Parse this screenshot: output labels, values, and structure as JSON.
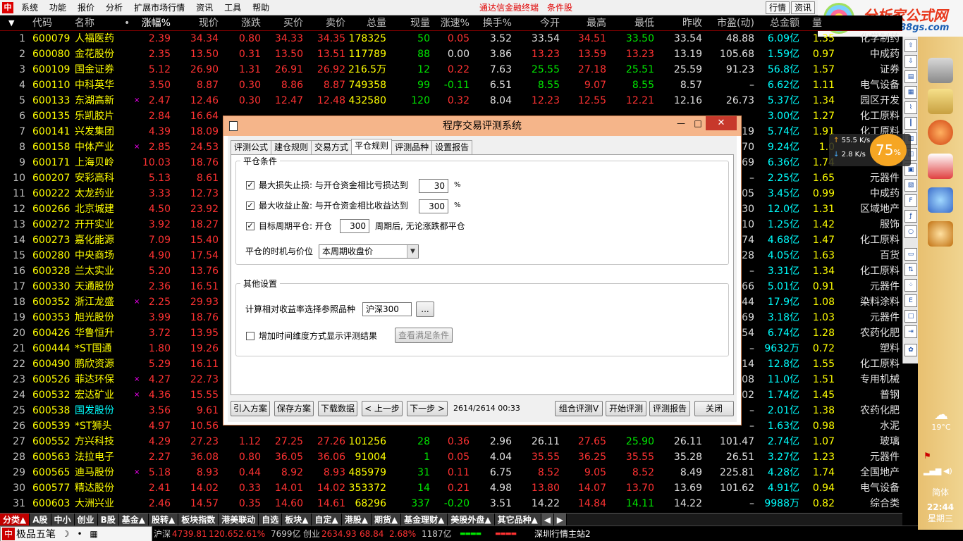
{
  "menubar": {
    "app_icon": "中",
    "items": [
      "系统",
      "功能",
      "报价",
      "分析",
      "扩展市场行情",
      "资讯",
      "工具",
      "帮助"
    ],
    "brand": "通达信金融终端",
    "brand2": "条件股",
    "btn_quote": "行情",
    "btn_info": "资讯"
  },
  "logo": {
    "title": "分析家公式网",
    "url": "www.88gs.com"
  },
  "table": {
    "headers": [
      "代码",
      "名称",
      "•",
      "涨幅%",
      "现价",
      "涨跌",
      "买价",
      "卖价",
      "总量",
      "现量",
      "涨速%",
      "换手%",
      "今开",
      "最高",
      "最低",
      "昨收",
      "市盈(动)",
      "总金额",
      "量"
    ],
    "rows": [
      {
        "idx": "1",
        "code": "600079",
        "name": "人福医药",
        "mark": "",
        "chg_pct": "2.39",
        "price": "34.34",
        "chg": "0.80",
        "bid": "34.33",
        "ask": "34.35",
        "vol": "178325",
        "cur": "50",
        "speed": "0.05",
        "turn": "3.52",
        "open": "33.54",
        "high": "34.51",
        "low": "33.50",
        "prev": "33.54",
        "pe": "48.88",
        "amt": "6.09亿",
        "ratio": "1.35",
        "ind": "化学制药"
      },
      {
        "idx": "2",
        "code": "600080",
        "name": "金花股份",
        "mark": "",
        "chg_pct": "2.35",
        "price": "13.50",
        "chg": "0.31",
        "bid": "13.50",
        "ask": "13.51",
        "vol": "117789",
        "cur": "88",
        "speed": "0.00",
        "turn": "3.86",
        "open": "13.23",
        "high": "13.59",
        "low": "13.23",
        "prev": "13.19",
        "pe": "105.68",
        "amt": "1.59亿",
        "ratio": "0.97",
        "ind": "中成药"
      },
      {
        "idx": "3",
        "code": "600109",
        "name": "国金证券",
        "mark": "",
        "chg_pct": "5.12",
        "price": "26.90",
        "chg": "1.31",
        "bid": "26.91",
        "ask": "26.92",
        "vol": "216.5万",
        "cur": "12",
        "speed": "0.22",
        "turn": "7.63",
        "open": "25.55",
        "high": "27.18",
        "low": "25.51",
        "prev": "25.59",
        "pe": "91.23",
        "amt": "56.8亿",
        "ratio": "1.57",
        "ind": "证券"
      },
      {
        "idx": "4",
        "code": "600110",
        "name": "中科英华",
        "mark": "",
        "chg_pct": "3.50",
        "price": "8.87",
        "chg": "0.30",
        "bid": "8.86",
        "ask": "8.87",
        "vol": "749358",
        "cur": "99",
        "speed": "-0.11",
        "turn": "6.51",
        "open": "8.55",
        "high": "9.07",
        "low": "8.55",
        "prev": "8.57",
        "pe": "–",
        "amt": "6.62亿",
        "ratio": "1.11",
        "ind": "电气设备"
      },
      {
        "idx": "5",
        "code": "600133",
        "name": "东湖高新",
        "mark": "×",
        "chg_pct": "2.47",
        "price": "12.46",
        "chg": "0.30",
        "bid": "12.47",
        "ask": "12.48",
        "vol": "432580",
        "cur": "120",
        "speed": "0.32",
        "turn": "8.04",
        "open": "12.23",
        "high": "12.55",
        "low": "12.21",
        "prev": "12.16",
        "pe": "26.73",
        "amt": "5.37亿",
        "ratio": "1.34",
        "ind": "园区开发"
      },
      {
        "idx": "6",
        "code": "600135",
        "name": "乐凯胶片",
        "mark": "",
        "chg_pct": "2.84",
        "price": "16.64",
        "chg": "",
        "bid": "",
        "ask": "",
        "vol": "",
        "cur": "",
        "speed": "",
        "turn": "",
        "open": "",
        "high": "",
        "low": "",
        "prev": "",
        "pe": "",
        "amt": "3.00亿",
        "ratio": "1.27",
        "ind": "化工原料"
      },
      {
        "idx": "7",
        "code": "600141",
        "name": "兴发集团",
        "mark": "",
        "chg_pct": "4.39",
        "price": "18.09",
        "chg": "",
        "bid": "",
        "ask": "",
        "vol": "",
        "cur": "",
        "speed": "",
        "turn": "",
        "open": "",
        "high": "",
        "low": "",
        "prev": "",
        "pe": "19",
        "amt": "5.74亿",
        "ratio": "1.91",
        "ind": "化工原料"
      },
      {
        "idx": "8",
        "code": "600158",
        "name": "中体产业",
        "mark": "×",
        "chg_pct": "2.85",
        "price": "24.53",
        "chg": "",
        "bid": "",
        "ask": "",
        "vol": "",
        "cur": "",
        "speed": "",
        "turn": "",
        "open": "",
        "high": "",
        "low": "",
        "prev": "",
        "pe": "70",
        "amt": "9.24亿",
        "ratio": "1.0",
        "ind": ""
      },
      {
        "idx": "9",
        "code": "600171",
        "name": "上海贝岭",
        "mark": "",
        "chg_pct": "10.03",
        "price": "18.76",
        "chg": "",
        "bid": "",
        "ask": "",
        "vol": "",
        "cur": "",
        "speed": "",
        "turn": "",
        "open": "",
        "high": "",
        "low": "",
        "prev": "",
        "pe": "69",
        "amt": "6.36亿",
        "ratio": "1.74",
        "ind": ""
      },
      {
        "idx": "10",
        "code": "600207",
        "name": "安彩高科",
        "mark": "",
        "chg_pct": "5.13",
        "price": "8.61",
        "chg": "",
        "bid": "",
        "ask": "",
        "vol": "",
        "cur": "",
        "speed": "",
        "turn": "",
        "open": "",
        "high": "",
        "low": "",
        "prev": "",
        "pe": "–",
        "amt": "2.25亿",
        "ratio": "1.65",
        "ind": "元器件"
      },
      {
        "idx": "11",
        "code": "600222",
        "name": "太龙药业",
        "mark": "",
        "chg_pct": "3.33",
        "price": "12.73",
        "chg": "",
        "bid": "",
        "ask": "",
        "vol": "",
        "cur": "",
        "speed": "",
        "turn": "",
        "open": "",
        "high": "",
        "low": "",
        "prev": "",
        "pe": "05",
        "amt": "3.45亿",
        "ratio": "0.99",
        "ind": "中成药"
      },
      {
        "idx": "12",
        "code": "600266",
        "name": "北京城建",
        "mark": "",
        "chg_pct": "4.50",
        "price": "23.92",
        "chg": "",
        "bid": "",
        "ask": "",
        "vol": "",
        "cur": "",
        "speed": "",
        "turn": "",
        "open": "",
        "high": "",
        "low": "",
        "prev": "",
        "pe": "30",
        "amt": "12.0亿",
        "ratio": "1.31",
        "ind": "区域地产"
      },
      {
        "idx": "13",
        "code": "600272",
        "name": "开开实业",
        "mark": "",
        "chg_pct": "3.92",
        "price": "18.27",
        "chg": "",
        "bid": "",
        "ask": "",
        "vol": "",
        "cur": "",
        "speed": "",
        "turn": "",
        "open": "",
        "high": "",
        "low": "",
        "prev": "",
        "pe": "10",
        "amt": "1.25亿",
        "ratio": "1.42",
        "ind": "服饰"
      },
      {
        "idx": "14",
        "code": "600273",
        "name": "嘉化能源",
        "mark": "",
        "chg_pct": "7.09",
        "price": "15.40",
        "chg": "",
        "bid": "",
        "ask": "",
        "vol": "",
        "cur": "",
        "speed": "",
        "turn": "",
        "open": "",
        "high": "",
        "low": "",
        "prev": "",
        "pe": "74",
        "amt": "4.68亿",
        "ratio": "1.47",
        "ind": "化工原料"
      },
      {
        "idx": "15",
        "code": "600280",
        "name": "中央商场",
        "mark": "",
        "chg_pct": "4.90",
        "price": "17.54",
        "chg": "",
        "bid": "",
        "ask": "",
        "vol": "",
        "cur": "",
        "speed": "",
        "turn": "",
        "open": "",
        "high": "",
        "low": "",
        "prev": "",
        "pe": "28",
        "amt": "4.05亿",
        "ratio": "1.63",
        "ind": "百货"
      },
      {
        "idx": "16",
        "code": "600328",
        "name": "兰太实业",
        "mark": "",
        "chg_pct": "5.20",
        "price": "13.76",
        "chg": "",
        "bid": "",
        "ask": "",
        "vol": "",
        "cur": "",
        "speed": "",
        "turn": "",
        "open": "",
        "high": "",
        "low": "",
        "prev": "",
        "pe": "–",
        "amt": "3.31亿",
        "ratio": "1.34",
        "ind": "化工原料"
      },
      {
        "idx": "17",
        "code": "600330",
        "name": "天通股份",
        "mark": "",
        "chg_pct": "2.36",
        "price": "16.51",
        "chg": "",
        "bid": "",
        "ask": "",
        "vol": "",
        "cur": "",
        "speed": "",
        "turn": "",
        "open": "",
        "high": "",
        "low": "",
        "prev": "",
        "pe": "66",
        "amt": "5.01亿",
        "ratio": "0.91",
        "ind": "元器件"
      },
      {
        "idx": "18",
        "code": "600352",
        "name": "浙江龙盛",
        "mark": "×",
        "chg_pct": "2.25",
        "price": "29.93",
        "chg": "",
        "bid": "",
        "ask": "",
        "vol": "",
        "cur": "",
        "speed": "",
        "turn": "",
        "open": "",
        "high": "",
        "low": "",
        "prev": "",
        "pe": "44",
        "amt": "17.9亿",
        "ratio": "1.08",
        "ind": "染料涂料"
      },
      {
        "idx": "19",
        "code": "600353",
        "name": "旭光股份",
        "mark": "",
        "chg_pct": "3.99",
        "price": "18.76",
        "chg": "",
        "bid": "",
        "ask": "",
        "vol": "",
        "cur": "",
        "speed": "",
        "turn": "",
        "open": "",
        "high": "",
        "low": "",
        "prev": "",
        "pe": "69",
        "amt": "3.18亿",
        "ratio": "1.03",
        "ind": "元器件"
      },
      {
        "idx": "20",
        "code": "600426",
        "name": "华鲁恒升",
        "mark": "",
        "chg_pct": "3.72",
        "price": "13.95",
        "chg": "",
        "bid": "",
        "ask": "",
        "vol": "",
        "cur": "",
        "speed": "",
        "turn": "",
        "open": "",
        "high": "",
        "low": "",
        "prev": "",
        "pe": "54",
        "amt": "6.74亿",
        "ratio": "1.28",
        "ind": "农药化肥"
      },
      {
        "idx": "21",
        "code": "600444",
        "name": "*ST国通",
        "mark": "",
        "chg_pct": "1.80",
        "price": "19.26",
        "chg": "",
        "bid": "",
        "ask": "",
        "vol": "",
        "cur": "",
        "speed": "",
        "turn": "",
        "open": "",
        "high": "",
        "low": "",
        "prev": "",
        "pe": "–",
        "amt": "9632万",
        "ratio": "0.72",
        "ind": "塑料"
      },
      {
        "idx": "22",
        "code": "600490",
        "name": "鹏欣资源",
        "mark": "",
        "chg_pct": "5.29",
        "price": "16.11",
        "chg": "",
        "bid": "",
        "ask": "",
        "vol": "",
        "cur": "",
        "speed": "",
        "turn": "",
        "open": "",
        "high": "",
        "low": "",
        "prev": "",
        "pe": "14",
        "amt": "12.8亿",
        "ratio": "1.55",
        "ind": "化工原料"
      },
      {
        "idx": "23",
        "code": "600526",
        "name": "菲达环保",
        "mark": "×",
        "chg_pct": "4.27",
        "price": "22.73",
        "chg": "",
        "bid": "",
        "ask": "",
        "vol": "",
        "cur": "",
        "speed": "",
        "turn": "",
        "open": "",
        "high": "",
        "low": "",
        "prev": "",
        "pe": "08",
        "amt": "11.0亿",
        "ratio": "1.51",
        "ind": "专用机械"
      },
      {
        "idx": "24",
        "code": "600532",
        "name": "宏达矿业",
        "mark": "×",
        "chg_pct": "4.36",
        "price": "15.55",
        "chg": "",
        "bid": "",
        "ask": "",
        "vol": "",
        "cur": "",
        "speed": "",
        "turn": "",
        "open": "",
        "high": "",
        "low": "",
        "prev": "",
        "pe": "02",
        "amt": "1.74亿",
        "ratio": "1.45",
        "ind": "普钢"
      },
      {
        "idx": "25",
        "code": "600538",
        "name": "国发股份",
        "mark": "",
        "chg_pct": "3.56",
        "price": "9.61",
        "chg": "",
        "bid": "",
        "ask": "",
        "vol": "",
        "cur": "",
        "speed": "",
        "turn": "",
        "open": "",
        "high": "",
        "low": "",
        "prev": "",
        "pe": "–",
        "amt": "2.01亿",
        "ratio": "1.38",
        "ind": "农药化肥"
      },
      {
        "idx": "26",
        "code": "600539",
        "name": "*ST狮头",
        "mark": "",
        "chg_pct": "4.97",
        "price": "10.56",
        "chg": "",
        "bid": "",
        "ask": "",
        "vol": "",
        "cur": "",
        "speed": "",
        "turn": "",
        "open": "",
        "high": "",
        "low": "",
        "prev": "",
        "pe": "–",
        "amt": "1.63亿",
        "ratio": "0.98",
        "ind": "水泥"
      },
      {
        "idx": "27",
        "code": "600552",
        "name": "方兴科技",
        "mark": "",
        "chg_pct": "4.29",
        "price": "27.23",
        "chg": "1.12",
        "bid": "27.25",
        "ask": "27.26",
        "vol": "101256",
        "cur": "28",
        "speed": "0.36",
        "turn": "2.96",
        "open": "26.11",
        "high": "27.65",
        "low": "25.90",
        "prev": "26.11",
        "pe": "101.47",
        "amt": "2.74亿",
        "ratio": "1.07",
        "ind": "玻璃"
      },
      {
        "idx": "28",
        "code": "600563",
        "name": "法拉电子",
        "mark": "",
        "chg_pct": "2.27",
        "price": "36.08",
        "chg": "0.80",
        "bid": "36.05",
        "ask": "36.06",
        "vol": "91004",
        "cur": "1",
        "speed": "0.05",
        "turn": "4.04",
        "open": "35.55",
        "high": "36.25",
        "low": "35.55",
        "prev": "35.28",
        "pe": "26.51",
        "amt": "3.27亿",
        "ratio": "1.23",
        "ind": "元器件"
      },
      {
        "idx": "29",
        "code": "600565",
        "name": "迪马股份",
        "mark": "×",
        "chg_pct": "5.18",
        "price": "8.93",
        "chg": "0.44",
        "bid": "8.92",
        "ask": "8.93",
        "vol": "485979",
        "cur": "31",
        "speed": "0.11",
        "turn": "6.75",
        "open": "8.52",
        "high": "9.05",
        "low": "8.52",
        "prev": "8.49",
        "pe": "225.81",
        "amt": "4.28亿",
        "ratio": "1.74",
        "ind": "全国地产"
      },
      {
        "idx": "30",
        "code": "600577",
        "name": "精达股份",
        "mark": "",
        "chg_pct": "2.41",
        "price": "14.02",
        "chg": "0.33",
        "bid": "14.01",
        "ask": "14.02",
        "vol": "353372",
        "cur": "14",
        "speed": "0.21",
        "turn": "4.98",
        "open": "13.80",
        "high": "14.07",
        "low": "13.70",
        "prev": "13.69",
        "pe": "101.62",
        "amt": "4.91亿",
        "ratio": "0.94",
        "ind": "电气设备"
      },
      {
        "idx": "31",
        "code": "600603",
        "name": "大洲兴业",
        "mark": "",
        "chg_pct": "2.46",
        "price": "14.57",
        "chg": "0.35",
        "bid": "14.60",
        "ask": "14.61",
        "vol": "68296",
        "cur": "337",
        "speed": "-0.20",
        "turn": "3.51",
        "open": "14.22",
        "high": "14.84",
        "low": "14.11",
        "prev": "14.22",
        "pe": "–",
        "amt": "9988万",
        "ratio": "0.82",
        "ind": "综合类"
      }
    ]
  },
  "net_widget": {
    "up": "55.5 K/s",
    "down": "2.8 K/s",
    "pct": "75",
    "pct_unit": "%"
  },
  "weather": {
    "temp": "19°C"
  },
  "clock": {
    "ime": "简体",
    "time": "22:44",
    "weekday": "星期三"
  },
  "tabbar": {
    "items": [
      "分类▲",
      "A股",
      "中小",
      "创业",
      "B股",
      "基金▲",
      "股转▲",
      "板块指数",
      "港美联动",
      "自选",
      "板块▲",
      "自定▲",
      "港股▲",
      "期货▲",
      "基金理财▲",
      "美股外盘▲",
      "其它品种▲"
    ]
  },
  "statusbar": {
    "ime_logo": "中",
    "ime_name": "极品五笔",
    "ime_moon": "☽",
    "ime_dot": "•",
    "ime_kb": "▦",
    "idx1_name": "沪深",
    "idx1_val": "4739.81",
    "idx1_chg": "120.65",
    "idx1_pct": "2.61%",
    "idx1_amt": "7699亿",
    "idx2_name": "创业",
    "idx2_val": "2634.93",
    "idx2_chg": "68.84",
    "idx2_pct": "2.68%",
    "idx2_amt": "1187亿",
    "server": "深圳行情主站2"
  },
  "dialog": {
    "title": "程序交易评测系统",
    "tabs": [
      "评测公式",
      "建仓规则",
      "交易方式",
      "平仓规则",
      "评测品种",
      "设置报告"
    ],
    "active_tab": 3,
    "group1_title": "平仓条件",
    "stop_loss_label": "最大损失止损: 与开仓资金相比亏损达到",
    "stop_loss_value": "30",
    "stop_profit_label": "最大收益止盈: 与开仓资金相比收益达到",
    "stop_profit_value": "300",
    "pct_unit": "%",
    "period_label": "目标周期平仓: 开仓",
    "period_value": "300",
    "period_suffix": "周期后, 无论涨跌都平仓",
    "timing_label": "平仓的时机与价位",
    "timing_value": "本周期收盘价",
    "group2_title": "其他设置",
    "ref_label": "计算相对收益率选择参照品种",
    "ref_value": "沪深300",
    "ref_btn": "...",
    "time_dim_label": "增加时间维度方式显示评测结果",
    "view_btn": "查看满足条件",
    "btn_import": "引入方案",
    "btn_save": "保存方案",
    "btn_download": "下载数据",
    "btn_prev": "< 上一步",
    "btn_next": "下一步 >",
    "progress": "2614/2614  00:33",
    "btn_combo": "组合评测V",
    "btn_start": "开始评测",
    "btn_report": "评测报告",
    "btn_close": "关闭",
    "check": "✓",
    "win_min": "—",
    "win_max": "□",
    "win_close": "✕"
  },
  "colors": {
    "up": "#ff3232",
    "down": "#00e600",
    "name": "#ffff00",
    "dialog_title": "#f5b58a",
    "close_btn": "#c7382b"
  }
}
